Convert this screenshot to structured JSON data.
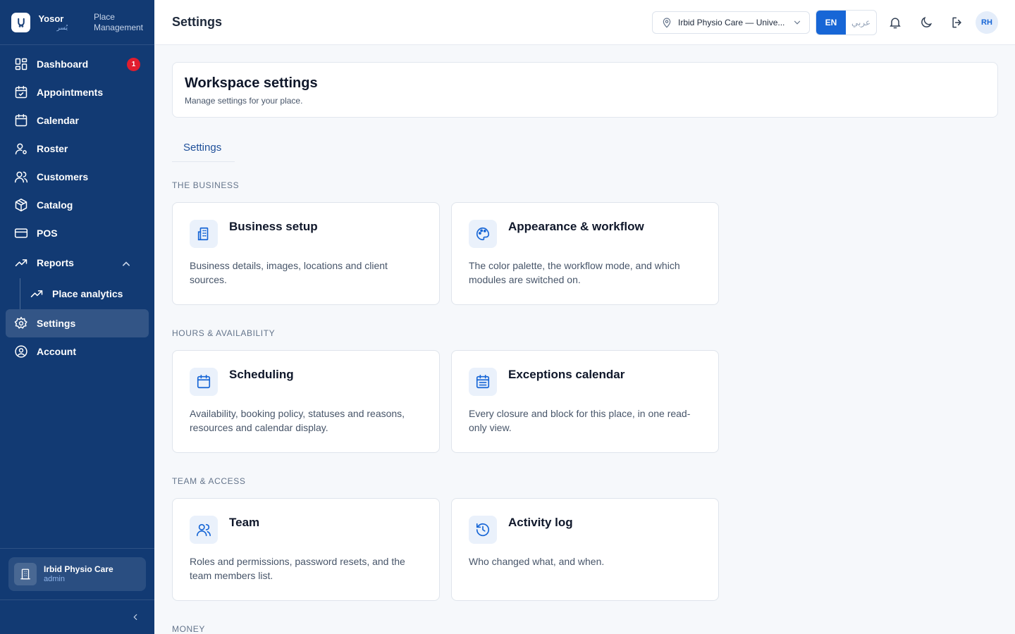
{
  "brand": {
    "name": "Yosor",
    "name_ar": "يُسر",
    "subtitle_line1": "Place",
    "subtitle_line2": "Management"
  },
  "sidebar": {
    "items": [
      {
        "label": "Dashboard",
        "icon": "dashboard-icon",
        "badge": "1"
      },
      {
        "label": "Appointments",
        "icon": "calendar-check-icon"
      },
      {
        "label": "Calendar",
        "icon": "calendar-icon"
      },
      {
        "label": "Roster",
        "icon": "user-cog-icon"
      },
      {
        "label": "Customers",
        "icon": "users-icon"
      },
      {
        "label": "Catalog",
        "icon": "package-icon"
      },
      {
        "label": "POS",
        "icon": "credit-card-icon"
      },
      {
        "label": "Reports",
        "icon": "trending-up-icon",
        "expanded": true
      },
      {
        "label": "Place analytics",
        "icon": "trending-up-icon"
      },
      {
        "label": "Settings",
        "icon": "gear-icon",
        "active": true
      },
      {
        "label": "Account",
        "icon": "user-circle-icon"
      }
    ],
    "org": {
      "name": "Irbid Physio Care",
      "role": "admin"
    }
  },
  "header": {
    "title": "Settings",
    "place_select": "Irbid Physio Care — Unive...",
    "lang_en": "EN",
    "lang_ar": "عربي",
    "avatar": "RH"
  },
  "workspace": {
    "title": "Workspace settings",
    "subtitle": "Manage settings for your place."
  },
  "tabs": [
    {
      "label": "Settings"
    }
  ],
  "sections": [
    {
      "label": "THE BUSINESS",
      "cards": [
        {
          "title": "Business setup",
          "desc": "Business details, images, locations and client sources.",
          "icon": "building-icon"
        },
        {
          "title": "Appearance & workflow",
          "desc": "The color palette, the workflow mode, and which modules are switched on.",
          "icon": "palette-icon"
        }
      ]
    },
    {
      "label": "HOURS & AVAILABILITY",
      "cards": [
        {
          "title": "Scheduling",
          "desc": "Availability, booking policy, statuses and reasons, resources and calendar display.",
          "icon": "calendar-icon"
        },
        {
          "title": "Exceptions calendar",
          "desc": "Every closure and block for this place, in one read-only view.",
          "icon": "calendar-list-icon"
        }
      ]
    },
    {
      "label": "TEAM & ACCESS",
      "cards": [
        {
          "title": "Team",
          "desc": "Roles and permissions, password resets, and the team members list.",
          "icon": "users-icon"
        },
        {
          "title": "Activity log",
          "desc": "Who changed what, and when.",
          "icon": "history-icon"
        }
      ]
    },
    {
      "label": "MONEY",
      "cards": []
    }
  ],
  "colors": {
    "sidebar_bg": "#123a73",
    "accent": "#1766d6",
    "badge": "#e11d2e"
  }
}
